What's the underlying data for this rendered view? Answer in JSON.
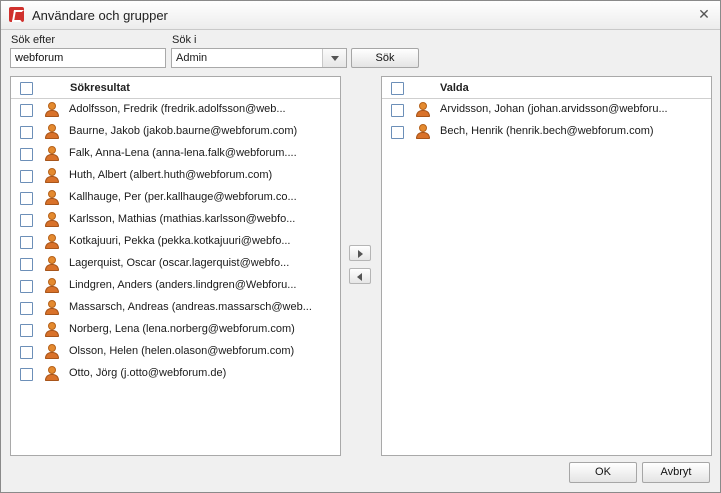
{
  "window": {
    "title": "Användare och grupper",
    "close_glyph": "✕"
  },
  "search": {
    "label": "Sök efter",
    "value": "webforum",
    "scope_label": "Sök i",
    "scope_value": "Admin",
    "button": "Sök"
  },
  "results": {
    "header": "Sökresultat",
    "items": [
      {
        "label": "Adolfsson, Fredrik (fredrik.adolfsson@web..."
      },
      {
        "label": "Baurne, Jakob (jakob.baurne@webforum.com)"
      },
      {
        "label": "Falk, Anna-Lena (anna-lena.falk@webforum...."
      },
      {
        "label": "Huth, Albert (albert.huth@webforum.com)"
      },
      {
        "label": "Kallhauge, Per (per.kallhauge@webforum.co..."
      },
      {
        "label": "Karlsson, Mathias (mathias.karlsson@webfo..."
      },
      {
        "label": "Kotkajuuri, Pekka (pekka.kotkajuuri@webfo..."
      },
      {
        "label": "Lagerquist, Oscar (oscar.lagerquist@webfo..."
      },
      {
        "label": "Lindgren, Anders (anders.lindgren@Webforu..."
      },
      {
        "label": "Massarsch, Andreas (andreas.massarsch@web..."
      },
      {
        "label": "Norberg, Lena (lena.norberg@webforum.com)"
      },
      {
        "label": "Olsson, Helen (helen.olason@webforum.com)"
      },
      {
        "label": "Otto, Jörg (j.otto@webforum.de)"
      }
    ]
  },
  "selected": {
    "header": "Valda",
    "items": [
      {
        "label": "Arvidsson, Johan (johan.arvidsson@webforu..."
      },
      {
        "label": "Bech, Henrik (henrik.bech@webforum.com)"
      }
    ]
  },
  "footer": {
    "ok": "OK",
    "cancel": "Avbryt"
  },
  "colors": {
    "user_icon": "#e48a2f",
    "checkbox_border": "#6c8fb8"
  }
}
